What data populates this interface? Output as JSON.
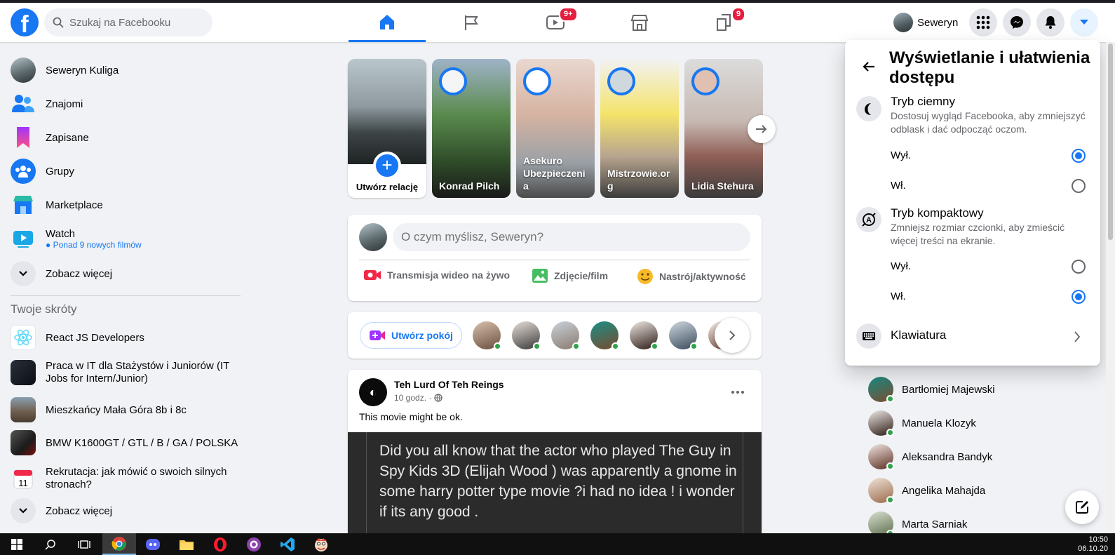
{
  "header": {
    "logo_letter": "f",
    "search_placeholder": "Szukaj na Facebooku",
    "tabs": [
      {
        "name": "home",
        "badge": ""
      },
      {
        "name": "pages",
        "badge": ""
      },
      {
        "name": "watch",
        "badge": "9+"
      },
      {
        "name": "marketplace",
        "badge": ""
      },
      {
        "name": "gaming",
        "badge": "9"
      }
    ],
    "profile_name": "Seweryn"
  },
  "left_nav": {
    "items": [
      {
        "label": "Seweryn Kuliga",
        "icon": "avatar"
      },
      {
        "label": "Znajomi",
        "icon": "friends-icon"
      },
      {
        "label": "Zapisane",
        "icon": "bookmark-icon"
      },
      {
        "label": "Grupy",
        "icon": "groups-icon"
      },
      {
        "label": "Marketplace",
        "icon": "marketplace-icon"
      },
      {
        "label": "Watch",
        "icon": "watch-icon",
        "sub": "Ponad 9 nowych filmów"
      }
    ],
    "see_more": "Zobacz więcej",
    "shortcuts_title": "Twoje skróty",
    "shortcuts": [
      {
        "label": "React JS Developers"
      },
      {
        "label": "Praca w IT dla Stażystów i Juniorów (IT Jobs for Intern/Junior)"
      },
      {
        "label": "Mieszkańcy Mała Góra 8b i 8c"
      },
      {
        "label": "BMW K1600GT / GTL / B / GA / POLSKA"
      },
      {
        "label": "Rekrutacja: jak mówić o swoich silnych stronach?"
      }
    ],
    "see_more_2": "Zobacz więcej"
  },
  "stories": {
    "create_label": "Utwórz relację",
    "items": [
      {
        "name": "Konrad Pilch"
      },
      {
        "name": "Asekuro Ubezpieczeni a"
      },
      {
        "name": "Mistrzowie.or g"
      },
      {
        "name": "Lidia Stehura"
      }
    ]
  },
  "composer": {
    "placeholder": "O czym myślisz, Seweryn?",
    "live": "Transmisja wideo na żywo",
    "photo": "Zdjęcie/film",
    "feeling": "Nastrój/aktywność"
  },
  "rooms": {
    "create_room": "Utwórz pokój"
  },
  "post": {
    "author": "Teh Lurd Of Teh Reings",
    "time": "10 godz. ·",
    "text": "This movie might be ok.",
    "image_text": "Did you all know that the actor who played The Guy in Spy Kids 3D (Elijah Wood ) was apparently a gnome in some harry potter type movie ?i had no idea ! i wonder if its any good ."
  },
  "contacts": [
    {
      "name": "Bartłomiej Majewski"
    },
    {
      "name": "Manuela Klozyk"
    },
    {
      "name": "Aleksandra Bandyk"
    },
    {
      "name": "Angelika Mahajda"
    },
    {
      "name": "Marta Sarniak"
    }
  ],
  "panel": {
    "title": "Wyświetlanie i ułatwienia dostępu",
    "dark_mode_title": "Tryb ciemny",
    "dark_mode_desc": "Dostosuj wygląd Facebooka, aby zmniejszyć odblask i dać odpocząć oczom.",
    "compact_title": "Tryb kompaktowy",
    "compact_desc": "Zmniejsz rozmiar czcionki, aby zmieścić więcej treści na ekranie.",
    "off": "Wył.",
    "on": "Wł.",
    "dark_mode_selected": "off",
    "compact_selected": "on",
    "keyboard": "Klawiatura"
  },
  "taskbar": {
    "time": "10:50",
    "date": "06.10.20"
  },
  "colors": {
    "accent": "#1877f2",
    "badge": "#e41e3f",
    "online": "#31a24c"
  }
}
